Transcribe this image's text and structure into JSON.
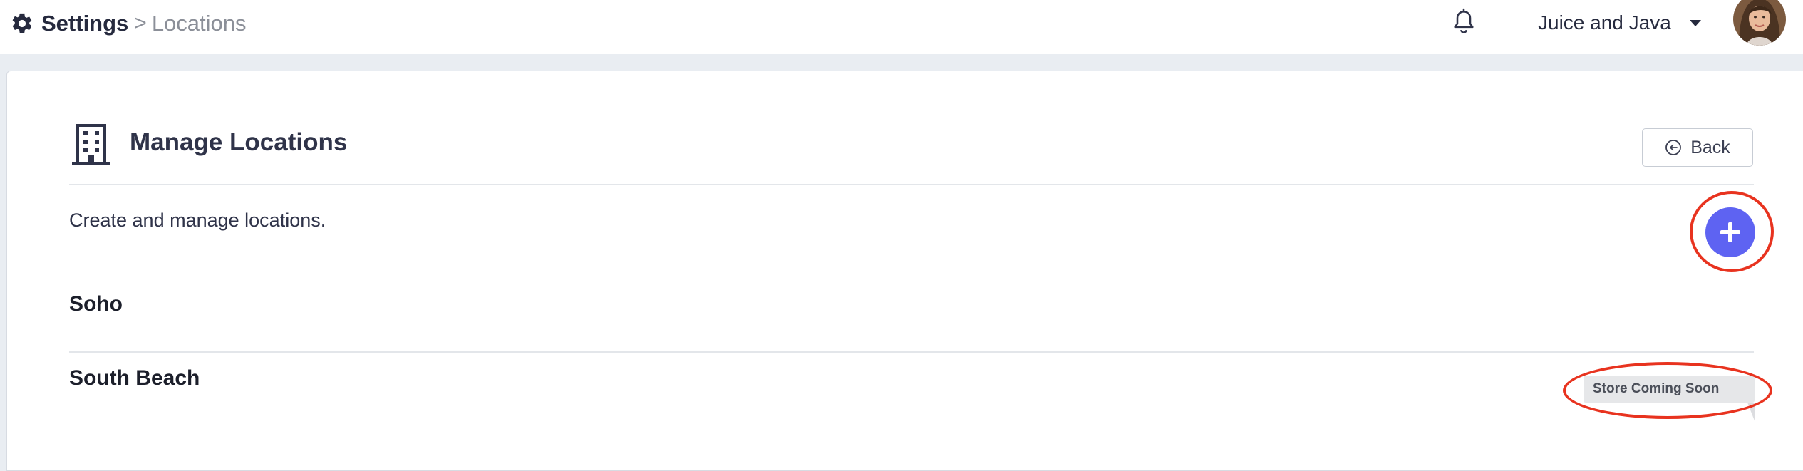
{
  "header": {
    "breadcrumb": {
      "section": "Settings",
      "separator": ">",
      "current": "Locations"
    },
    "organization": "Juice and Java",
    "icons": {
      "settings": "gear-icon",
      "notifications": "bell-icon",
      "dropdown": "caret-down-icon"
    }
  },
  "page": {
    "title": "Manage Locations",
    "title_icon": "building-icon",
    "back_label": "Back",
    "back_icon": "arrow-left-circle-icon",
    "subtitle": "Create and manage locations.",
    "add_icon": "plus-icon"
  },
  "locations": [
    {
      "name": "Soho",
      "badge": ""
    },
    {
      "name": "South Beach",
      "badge": "Store Coming Soon"
    }
  ],
  "colors": {
    "accent": "#5e63f2",
    "highlight": "#e8331f",
    "page_bg": "#e9edf2",
    "text": "#2f3349"
  }
}
